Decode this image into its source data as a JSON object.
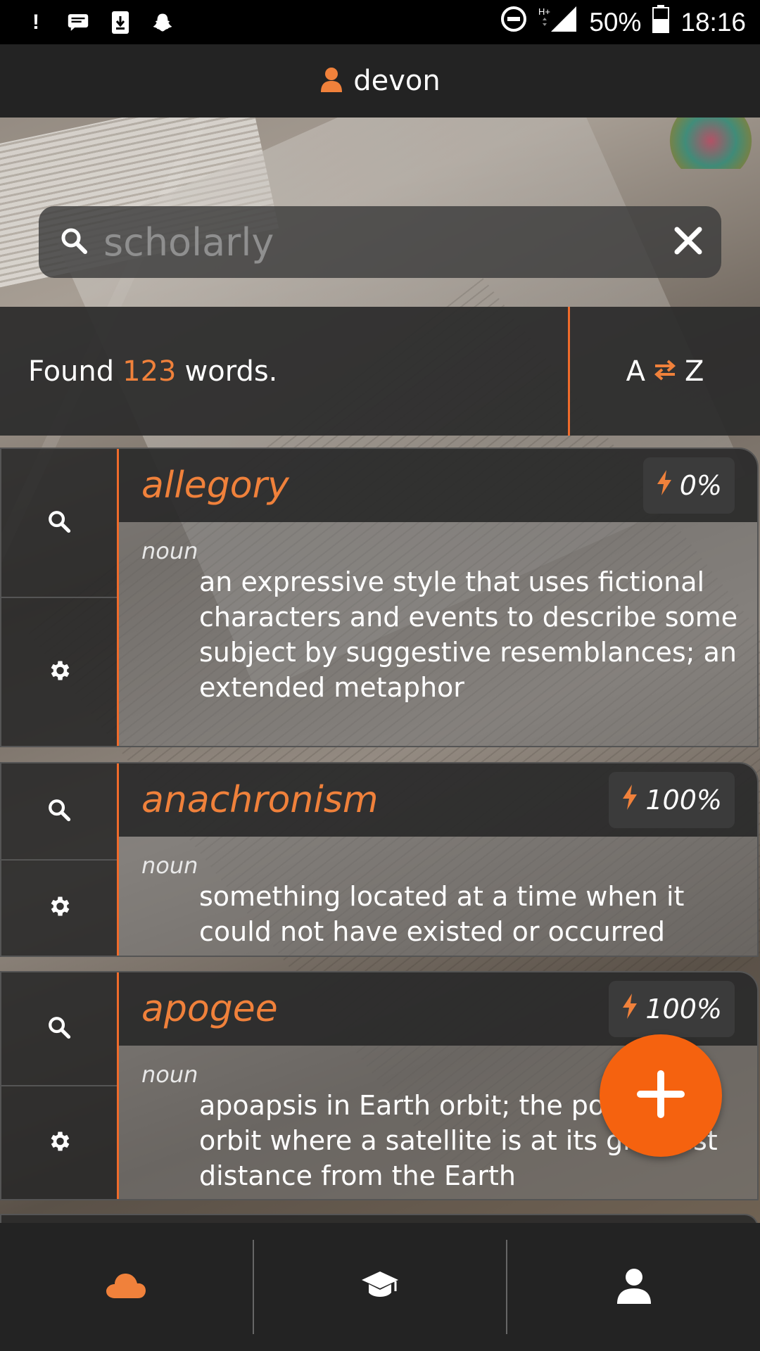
{
  "status_bar": {
    "battery": "50%",
    "time": "18:16",
    "network": "H+"
  },
  "header": {
    "username": "devon"
  },
  "search": {
    "placeholder": "scholarly"
  },
  "results": {
    "found_prefix": "Found",
    "count": "123",
    "found_suffix": "words."
  },
  "sort": {
    "from": "A",
    "to": "Z"
  },
  "words": [
    {
      "word": "allegory",
      "score": "0%",
      "pos": "noun",
      "definition": "an expressive style that uses fictional characters and events to describe some subject by suggestive resemblances; an extended metaphor"
    },
    {
      "word": "anachronism",
      "score": "100%",
      "pos": "noun",
      "definition": "something located at a time when it could not have existed or occurred"
    },
    {
      "word": "apogee",
      "score": "100%",
      "pos": "noun",
      "definition": "apoapsis in Earth orbit; the point in its orbit where a satellite is at its greatest distance from the Earth"
    }
  ],
  "colors": {
    "accent": "#f0813b",
    "fab": "#f5620f",
    "bar": "#232323"
  },
  "icons": {
    "status": [
      "exclamation-icon",
      "message-icon",
      "download-icon",
      "snapchat-icon",
      "do-not-disturb-icon",
      "signal-icon",
      "battery-icon"
    ],
    "nav": [
      "cloud-icon",
      "graduation-cap-icon",
      "profile-icon"
    ]
  }
}
